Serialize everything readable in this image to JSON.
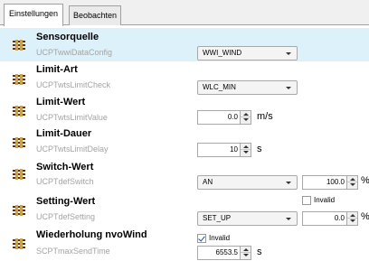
{
  "tabs": [
    {
      "label": "Einstellungen",
      "active": true
    },
    {
      "label": "Beobachten",
      "active": false
    }
  ],
  "rows": [
    {
      "name": "Sensorquelle",
      "sub": "UCPTwwiDataConfig",
      "combo": "WWI_WIND"
    },
    {
      "name": "Limit-Art",
      "sub": "UCPTwtsLimitCheck",
      "combo": "WLC_MIN"
    },
    {
      "name": "Limit-Wert",
      "sub": "UCPTwtsLimitValue",
      "spin": "0.0",
      "unit": "m/s"
    },
    {
      "name": "Limit-Dauer",
      "sub": "UCPTwtsLimitDelay",
      "spin": "10",
      "unit": "s"
    },
    {
      "name": "Switch-Wert",
      "sub": "UCPTdefSwitch",
      "combo": "AN",
      "spin2": "100.0",
      "unit2": "%"
    },
    {
      "name": "Setting-Wert",
      "sub": "UCPTdefSetting",
      "checkbox_label": "Invalid",
      "checkbox_checked": false,
      "combo": "SET_UP",
      "spin2": "0.0",
      "unit2": "%"
    },
    {
      "name": "Wiederholung nvoWind",
      "sub": "SCPTmaxSendTime",
      "checkbox_label": "Invalid",
      "checkbox_checked": true,
      "spin": "6553.5",
      "unit": "s"
    }
  ],
  "icons": {
    "row": "property-icon",
    "spinner": "spinner-arrows-icon",
    "dropdown": "chevron-down-icon"
  },
  "colors": {
    "selected_row": "#ddf1fb",
    "subtitle": "#a4a4a4",
    "icon_accent": "#6a2f00"
  }
}
